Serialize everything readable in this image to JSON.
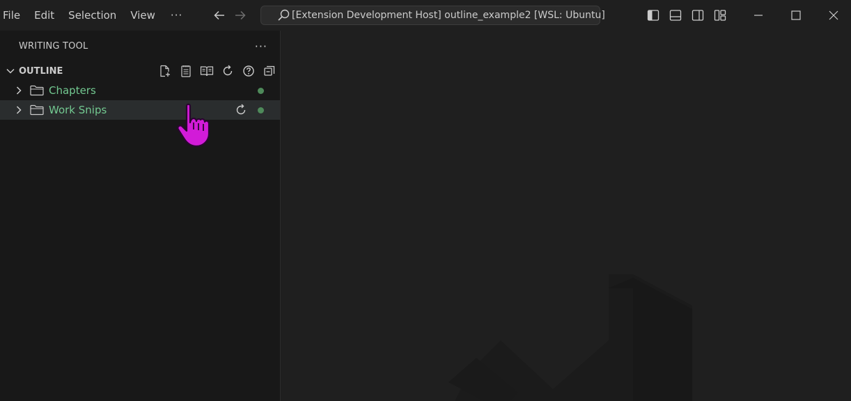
{
  "menu": {
    "items": [
      "File",
      "Edit",
      "Selection",
      "View"
    ],
    "more": "···"
  },
  "command_center": {
    "text": "[Extension Development Host] outline_example2 [WSL: Ubuntu]",
    "icon": "search-icon"
  },
  "sidebar": {
    "title": "WRITING TOOL",
    "more": "···",
    "section": {
      "title": "OUTLINE",
      "actions": [
        "new-file-icon",
        "notes-icon",
        "book-icon",
        "refresh-icon",
        "help-icon",
        "collapse-all-icon"
      ]
    },
    "tree": [
      {
        "label": "Chapters",
        "icon": "folder-icon"
      },
      {
        "label": "Work Snips",
        "icon": "folder-icon"
      }
    ]
  },
  "colors": {
    "tree_label": "#73c991",
    "status_dot": "#4e8a5a",
    "cursor": "#d21bd8"
  }
}
